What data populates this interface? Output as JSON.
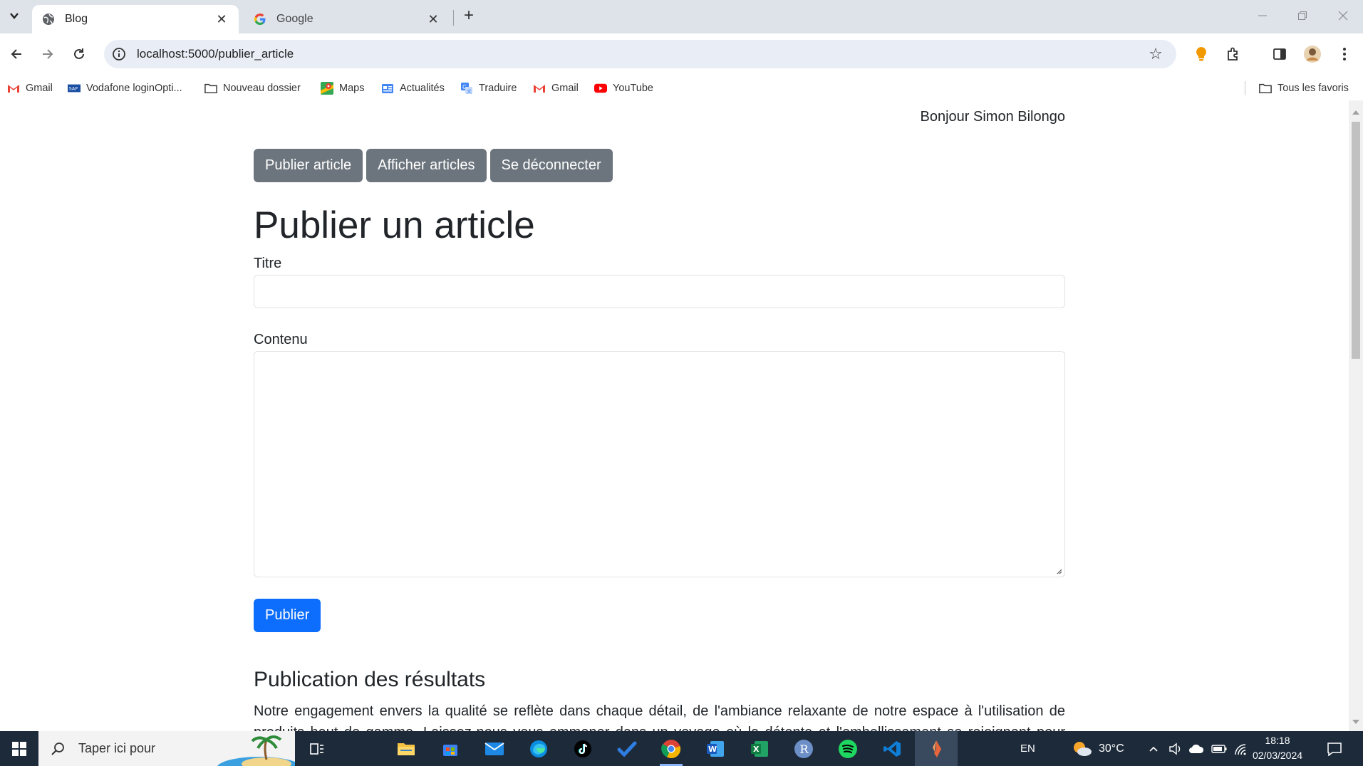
{
  "browser": {
    "tabs": [
      {
        "title": "Blog",
        "active": true
      },
      {
        "title": "Google",
        "active": false
      }
    ],
    "url": "localhost:5000/publier_article",
    "bookmarks": [
      {
        "label": "Gmail",
        "icon": "gmail-icon"
      },
      {
        "label": "Vodafone loginOpti...",
        "icon": "vodafone-icon"
      },
      {
        "label": "Nouveau dossier",
        "icon": "folder-icon"
      },
      {
        "label": "Maps",
        "icon": "maps-icon"
      },
      {
        "label": "Actualités",
        "icon": "news-icon"
      },
      {
        "label": "Traduire",
        "icon": "translate-icon"
      },
      {
        "label": "Gmail",
        "icon": "gmail-icon"
      },
      {
        "label": "YouTube",
        "icon": "youtube-icon"
      }
    ],
    "all_bookmarks": "Tous les favoris"
  },
  "page": {
    "greeting": "Bonjour Simon Bilongo",
    "nav": {
      "publish": "Publier article",
      "show": "Afficher articles",
      "logout": "Se déconnecter"
    },
    "title": "Publier un article",
    "form": {
      "title_label": "Titre",
      "title_value": "",
      "content_label": "Contenu",
      "content_value": "",
      "submit": "Publier"
    },
    "section_title": "Publication des résultats",
    "paragraph": "Notre engagement envers la qualité se reflète dans chaque détail, de l'ambiance relaxante de notre espace à l'utilisation de produits haut de gamme. Laissez-nous vous emmener dans un voyage où la détente et l'embellissement se rejoignent pour créer"
  },
  "taskbar": {
    "search_placeholder": "Taper ici pour",
    "language": "EN",
    "weather": "30°C",
    "time": "18:18",
    "date": "02/03/2024"
  },
  "colors": {
    "primary": "#0d6efd",
    "secondary": "#6c757d",
    "tabbar": "#dee3ea",
    "taskbar": "#1c2a3a"
  }
}
